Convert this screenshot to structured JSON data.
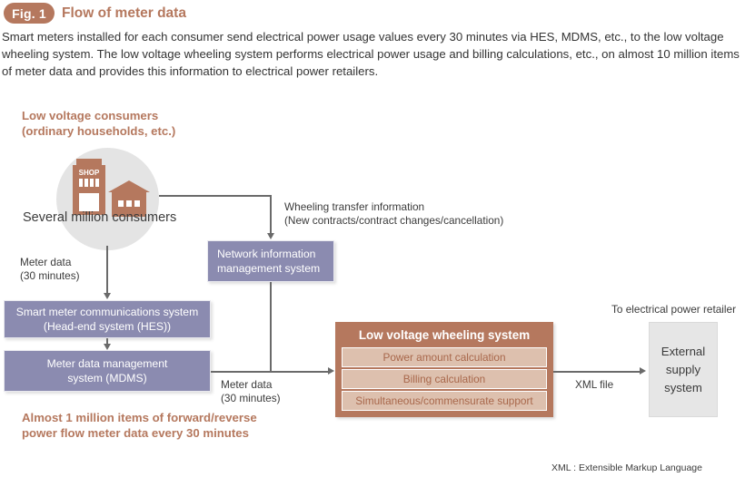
{
  "header": {
    "badge": "Fig. 1",
    "title": "Flow of meter data",
    "lead": "Smart meters installed for each consumer send electrical power usage values every 30 minutes via HES, MDMS, etc., to the low voltage wheeling system. The low voltage wheeling system performs electrical power usage and billing calculations, etc., on almost 10 million items of meter data and provides this information to electrical power retailers."
  },
  "diagram": {
    "consumers_label": "Low voltage consumers\n(ordinary households, etc.)",
    "several_million": "Several million consumers",
    "meter_data_left": "Meter data\n(30 minutes)",
    "meter_data_mid": "Meter data\n(30 minutes)",
    "wheeling_transfer_info": "Wheeling transfer information\n(New contracts/contract changes/cancellation)",
    "almost_million": "Almost 1 million items of forward/reverse\npower flow meter data every 30 minutes",
    "xml_file": "XML file",
    "to_retailer": "To electrical power retailer",
    "footnote": "XML : Extensible Markup Language",
    "boxes": {
      "network": "Network information\nmanagement system",
      "hes": "Smart meter communications system\n(Head-end system (HES))",
      "mdms": "Meter data management\nsystem (MDMS)",
      "external": "External\nsupply\nsystem"
    },
    "wheeling": {
      "title": "Low voltage wheeling system",
      "items": [
        "Power amount calculation",
        "Billing calculation",
        "Simultaneous/commensurate support"
      ]
    },
    "icons": {
      "shop_sign": "SHOP"
    }
  },
  "colors": {
    "brand_brown": "#b5785e",
    "system_purple": "#8b8bb0",
    "wheeling_item": "#ddc0ae",
    "circle_gray": "#e4e4e4",
    "external_gray": "#e6e6e6",
    "connector": "#6a6a6a"
  }
}
